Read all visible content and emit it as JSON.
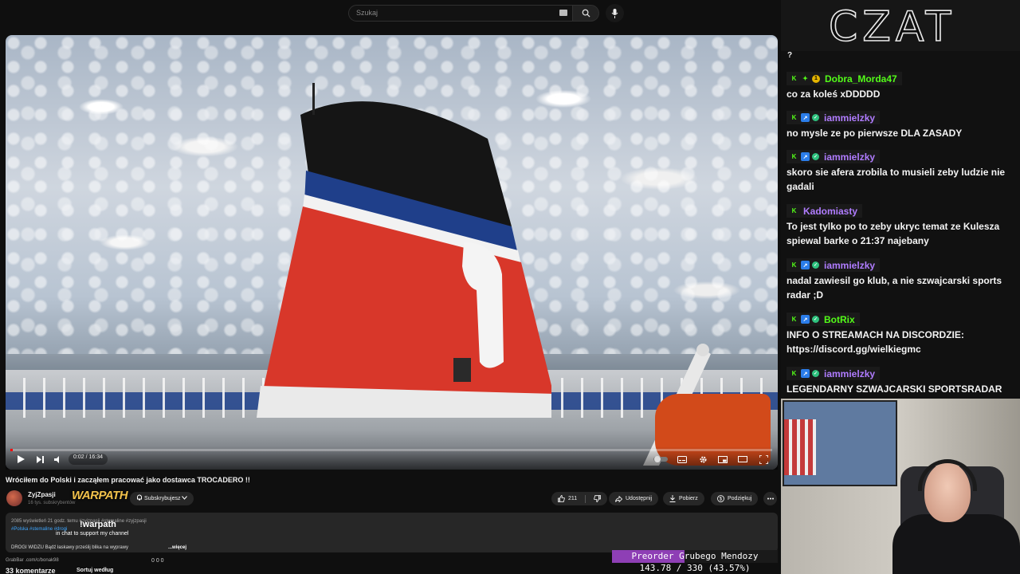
{
  "search": {
    "placeholder": "Szukaj"
  },
  "player": {
    "time": "0:02 / 16:34",
    "progress_fraction": 0.002
  },
  "video": {
    "title": "Wróciłem do Polski i zacząłem pracować jako dostawca TROCADERO !!",
    "channel": "ZyjZpasji",
    "subs": "16 tys. subskrybentów",
    "subscribe_label": "Subskrybujesz",
    "likes": "211",
    "share_label": "Udostępnij",
    "download_label": "Pobierz",
    "thanks_label": "Podziękuj"
  },
  "description": {
    "line1": "2085 wyświetleń  21 godz. temu  #zyjzpasji #stemaline #zyjzpasji",
    "line2": "#Polska #stemaline #drogi",
    "line3": "DROGI WIDZU Bądź łaskawy prześlij blika na wyprawy",
    "more": "...więcej"
  },
  "overlay": {
    "warpath_logo": "WARPATH",
    "warpath_handle": "!warpath",
    "warpath_text": "in chat to support my channel"
  },
  "footer": {
    "grabber": "GrabBar .com/c/bonak98",
    "comments": "33 komentarze",
    "sort": "Sortuj według",
    "mini_stats": "0  0  0"
  },
  "goal": {
    "label": "Preorder Grubego Mendozy",
    "value": "143.78 / 330 (43.57%)",
    "fraction": 0.4357,
    "color": "#8e3fb5"
  },
  "chat": {
    "logo": "CZAT",
    "top_fragment": "?",
    "messages": [
      {
        "user": "Dobra_Morda47",
        "color": "#53fc18",
        "badges": [
          "k",
          "star",
          "one"
        ],
        "text": "co za koleś xDDDDD"
      },
      {
        "user": "iammielzky",
        "color": "#b07cff",
        "badges": [
          "k",
          "sq",
          "ok"
        ],
        "text": "no mysle ze po pierwsze DLA ZASADY"
      },
      {
        "user": "iammielzky",
        "color": "#b07cff",
        "badges": [
          "k",
          "sq",
          "ok"
        ],
        "text": "skoro sie afera zrobila to musieli zeby ludzie nie gadali"
      },
      {
        "user": "Kadomiasty",
        "color": "#b07cff",
        "badges": [
          "k"
        ],
        "text": "To jest tylko po to zeby ukryc temat ze Kulesza spiewal barke o 21:37 najebany"
      },
      {
        "user": "iammielzky",
        "color": "#b07cff",
        "badges": [
          "k",
          "sq",
          "ok"
        ],
        "text": "nadal zawiesil go klub, a nie szwajcarski sports radar ;D"
      },
      {
        "user": "BotRix",
        "color": "#53fc18",
        "badges": [
          "k",
          "sq",
          "ok"
        ],
        "text": "INFO O STREAMACH NA DISCORDZIE: https://discord.gg/wielkiegmc"
      },
      {
        "user": "iammielzky",
        "color": "#b07cff",
        "badges": [
          "k",
          "sq",
          "ok"
        ],
        "text": "LEGENDARNY SZWAJCARSKI SPORTSRADAR"
      }
    ]
  }
}
